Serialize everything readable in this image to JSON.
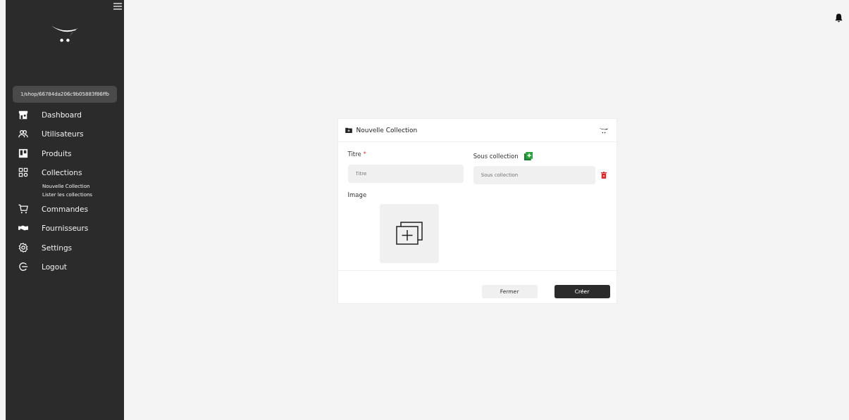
{
  "sidebar": {
    "shop_path": "1/shop/66784da206c9b05883f86ffb",
    "items": [
      {
        "label": "Dashboard"
      },
      {
        "label": "Utilisateurs"
      },
      {
        "label": "Produits"
      },
      {
        "label": "Collections",
        "children": [
          {
            "label": "Nouvelle Collection"
          },
          {
            "label": "Lister les collections"
          }
        ]
      },
      {
        "label": "Commandes"
      },
      {
        "label": "Fournisseurs"
      },
      {
        "label": "Settings"
      },
      {
        "label": "Logout"
      }
    ]
  },
  "modal": {
    "title": "Nouvelle Collection",
    "titre": {
      "label": "Titre",
      "required_mark": "*",
      "placeholder": "Titre"
    },
    "sous_collection": {
      "label": "Sous collection",
      "placeholder": "Sous collection"
    },
    "image": {
      "label": "Image"
    },
    "buttons": [
      {
        "label": "Fermer",
        "kind": "secondary"
      },
      {
        "label": "Créer",
        "kind": "primary"
      }
    ]
  }
}
